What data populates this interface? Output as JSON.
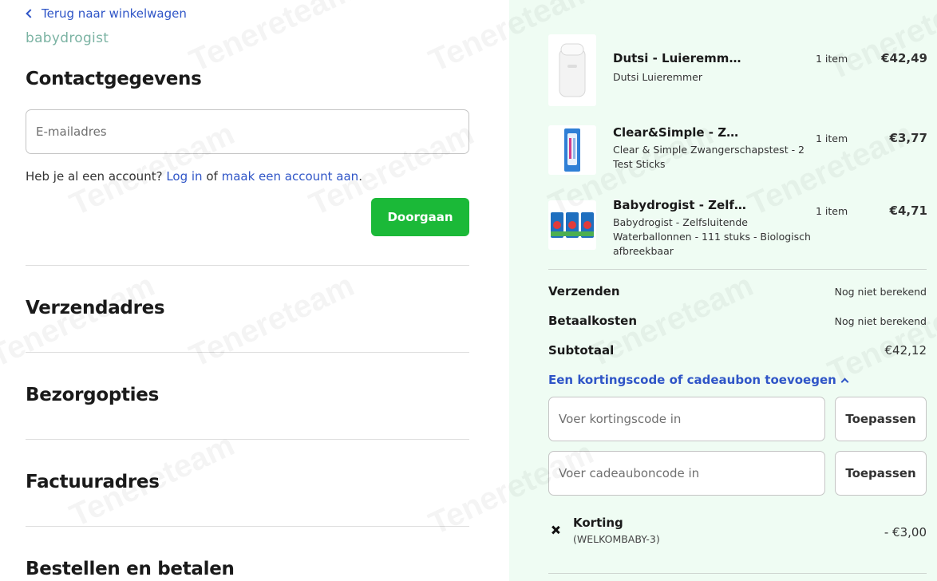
{
  "nav": {
    "back_label": "Terug naar winkelwagen"
  },
  "brand": {
    "logo_text": "babydrogist",
    "logo_color": "#7bb3a3"
  },
  "contact": {
    "title": "Contactgegevens",
    "email_placeholder": "E-mailadres",
    "account_prefix": "Heb je al een account?",
    "login_link": "Log in",
    "account_mid": "of",
    "create_link": "maak een account aan",
    "account_suffix": ".",
    "continue_button": "Doorgaan"
  },
  "sections": {
    "shipping_address": "Verzendadres",
    "delivery_options": "Bezorgopties",
    "billing_address": "Factuuradres",
    "order_pay": "Bestellen en betalen"
  },
  "cart": {
    "items": [
      {
        "name": "Dutsi - Luieremmer – Dutsi Luieremmer",
        "description": "Dutsi Luieremmer",
        "qty": "1 item",
        "price": "€42,49"
      },
      {
        "name": "Clear&Simple - Zwangerschapstest",
        "description": "Clear & Simple Zwangerschapstest - 2 Test Sticks",
        "qty": "1 item",
        "price": "€3,77"
      },
      {
        "name": "Babydrogist - Zelfsluitende Waterballonnen",
        "description": "Babydrogist - Zelfsluitende Waterballonnen - 111 stuks - Biologisch afbreekbaar",
        "qty": "1 item",
        "price": "€4,71"
      }
    ]
  },
  "summary": {
    "shipping_label": "Verzenden",
    "shipping_value": "Nog niet berekend",
    "payment_label": "Betaalkosten",
    "payment_value": "Nog niet berekend",
    "subtotal_label": "Subtotaal",
    "subtotal_value": "€42,12",
    "discount_toggle": "Een kortingscode of cadeaubon toevoegen",
    "discount_placeholder": "Voer kortingscode in",
    "giftcard_placeholder": "Voer cadeauboncode in",
    "apply_label": "Toepassen",
    "discount_label": "Korting",
    "discount_code": "(WELKOMBABY-3)",
    "discount_value": "- €3,00"
  },
  "colors": {
    "accent": "#2f55c7",
    "primary_button": "#1bb938",
    "summary_bg": "#effcf3"
  }
}
